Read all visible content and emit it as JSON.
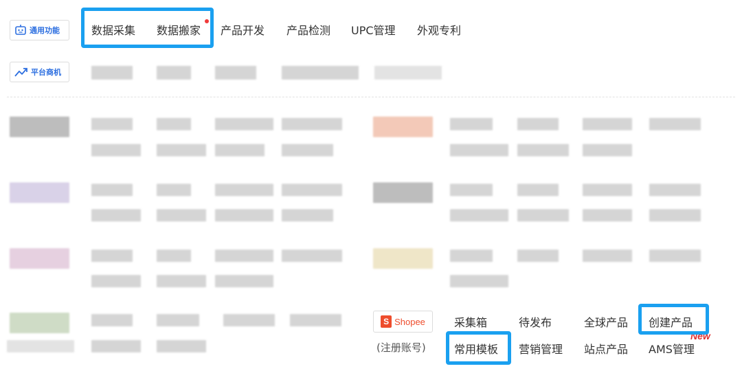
{
  "badges": {
    "general": "通用功能",
    "platform": "平台商机"
  },
  "top_nav": [
    {
      "label": "数据采集"
    },
    {
      "label": "数据搬家"
    },
    {
      "label": "产品开发"
    },
    {
      "label": "产品检测"
    },
    {
      "label": "UPC管理"
    },
    {
      "label": "外观专利"
    }
  ],
  "shopee": {
    "logo_text": "Shopee",
    "logo_letter": "S",
    "note": "(注册账号)",
    "links_row1": [
      "采集箱",
      "待发布",
      "全球产品",
      "创建产品"
    ],
    "links_row2": [
      "常用模板",
      "营销管理",
      "站点产品",
      "AMS管理"
    ],
    "new_tag": "New"
  },
  "colors": {
    "highlight": "#1aa0f0",
    "accent": "#2d6fe0",
    "shopee": "#ee4d2d",
    "new": "#e03030"
  }
}
